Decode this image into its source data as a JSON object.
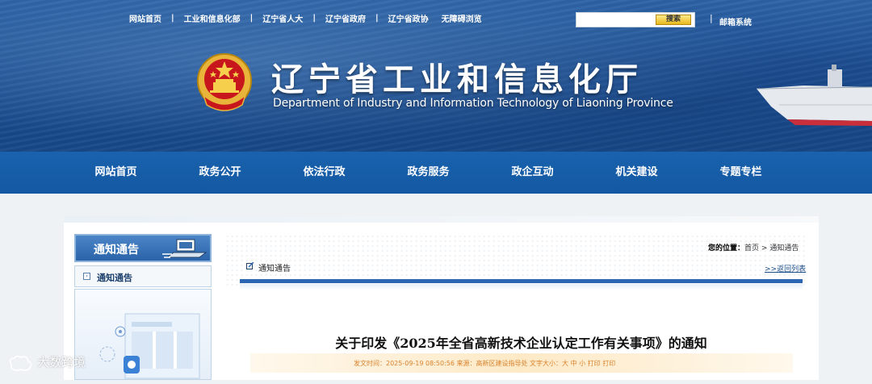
{
  "top_links": [
    "网站首页",
    "工业和信息化部",
    "辽宁省人大",
    "辽宁省政府",
    "辽宁省政协",
    "无障碍浏览"
  ],
  "search": {
    "button_label": "搜索"
  },
  "mail": "邮箱系统",
  "site": {
    "title_cn": "辽宁省工业和信息化厅",
    "title_en": "Department of Industry and Information Technology of Liaoning Province"
  },
  "nav": [
    "网站首页",
    "政务公开",
    "依法行政",
    "政务服务",
    "政企互动",
    "机关建设",
    "专题专栏"
  ],
  "sidebar": {
    "header": "通知通告",
    "item": "通知通告"
  },
  "location": {
    "label": "您的位置：",
    "home": "首页",
    "separator": ">",
    "current": "通知通告"
  },
  "section_title": "通知通告",
  "back_link": ">>返回列表",
  "article": {
    "title": "关于印发《2025年全省高新技术企业认定工作有关事项》的通知",
    "meta": "发文时间：2025-09-19 08:50:56 来源：高新区建设指导处   文字大小：大  中  小      打印   打印"
  },
  "watermark": "大数跨境",
  "colors": {
    "nav_bg": "#1a62ae",
    "header_bg": "#1d4f93",
    "rule_blue": "#2a66b2",
    "meta_text": "#d9822b"
  }
}
